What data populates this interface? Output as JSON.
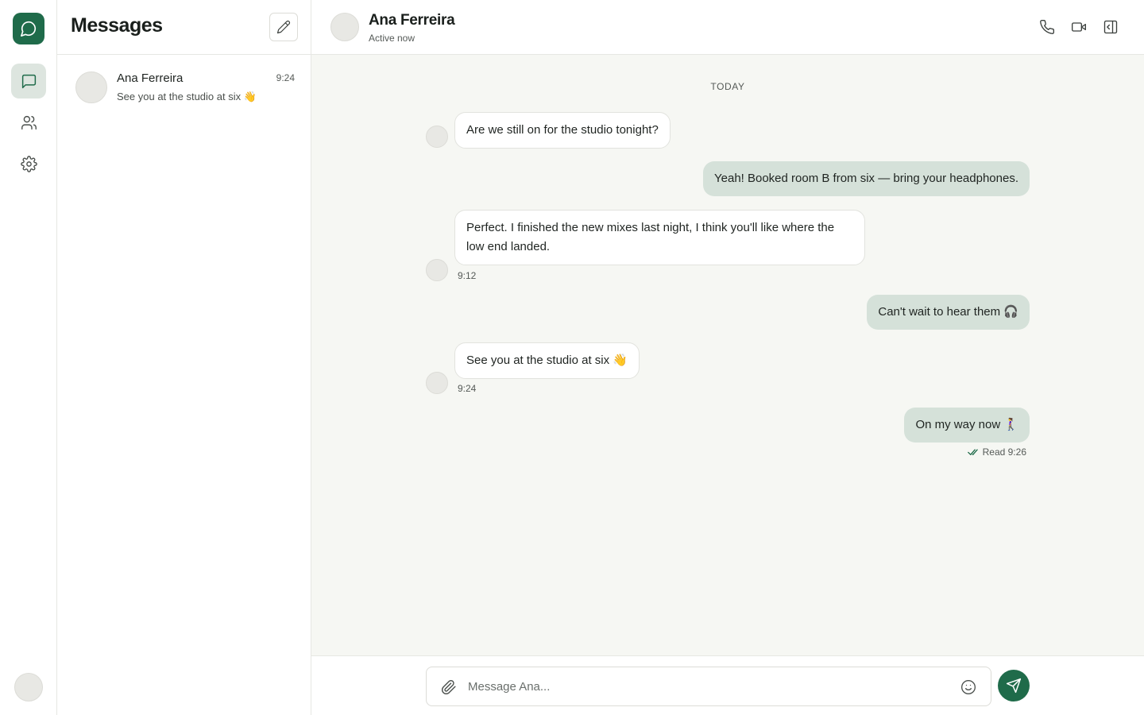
{
  "app": {
    "title": "Messages",
    "accent_color": "#1f6b4a"
  },
  "rail": {
    "logo_icon": "chat-bubble-icon",
    "items": [
      {
        "name": "chats",
        "icon": "message-square-icon",
        "active": true
      },
      {
        "name": "contacts",
        "icon": "users-icon",
        "active": false
      },
      {
        "name": "settings",
        "icon": "gear-icon",
        "active": false
      }
    ]
  },
  "conversations": [
    {
      "name": "Ana Ferreira",
      "time": "9:24",
      "preview": "See you at the studio at six 👋"
    }
  ],
  "chat": {
    "contact_name": "Ana Ferreira",
    "status": "Active now",
    "day_label": "TODAY",
    "messages": [
      {
        "direction": "in",
        "text": "Are we still on for the studio tonight?",
        "time": ""
      },
      {
        "direction": "out",
        "text": "Yeah! Booked room B from six — bring your headphones.",
        "time": ""
      },
      {
        "direction": "in",
        "text": "Perfect. I finished the new mixes last night, I think you'll like where the low end landed.",
        "time": "9:12"
      },
      {
        "direction": "out",
        "text": "Can't wait to hear them 🎧",
        "time": ""
      },
      {
        "direction": "in",
        "text": "See you at the studio at six 👋",
        "time": "9:24"
      },
      {
        "direction": "out",
        "text": "On my way now 🚶‍♀️",
        "time": ""
      }
    ],
    "read_receipt": "Read 9:26"
  },
  "composer": {
    "placeholder": "Message Ana..."
  }
}
